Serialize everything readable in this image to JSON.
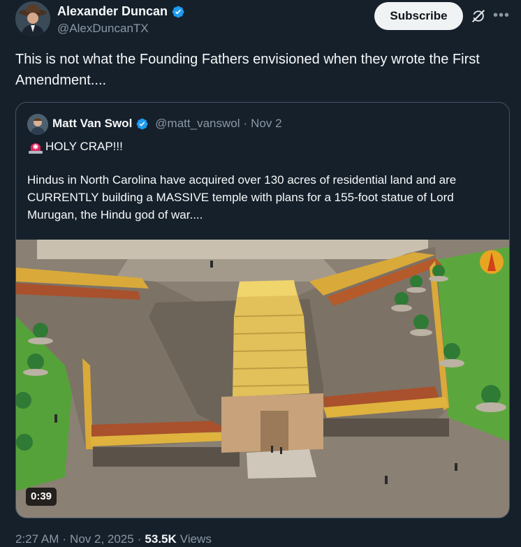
{
  "author": {
    "name": "Alexander Duncan",
    "handle": "@AlexDuncanTX",
    "verified": true
  },
  "actions": {
    "subscribe_label": "Subscribe",
    "grok_icon": "grok-icon",
    "more_icon": "more-icon"
  },
  "tweet": {
    "text": "This is not what the Founding Fathers envisioned when they wrote the First Amendment...."
  },
  "quote": {
    "name": "Matt Van Swol",
    "handle": "@matt_vanswol",
    "separator": "·",
    "date": "Nov 2",
    "line1": "HOLY CRAP!!!",
    "line1_icon": "police-light-icon",
    "body": "Hindus in North Carolina have acquired over 130 acres of residential land and are CURRENTLY building a MASSIVE temple with plans for a 155-foot statue of Lord Murugan, the Hindu god of war....",
    "media": {
      "type": "video",
      "duration": "0:39"
    }
  },
  "meta": {
    "time": "2:27 AM",
    "sep1": "·",
    "date": "Nov 2, 2025",
    "sep2": "·",
    "views_count": "53.5K",
    "views_label": "Views"
  },
  "colors": {
    "background": "#15202b",
    "verified": "#1d9bf0",
    "secondary_text": "#8b98a5"
  }
}
